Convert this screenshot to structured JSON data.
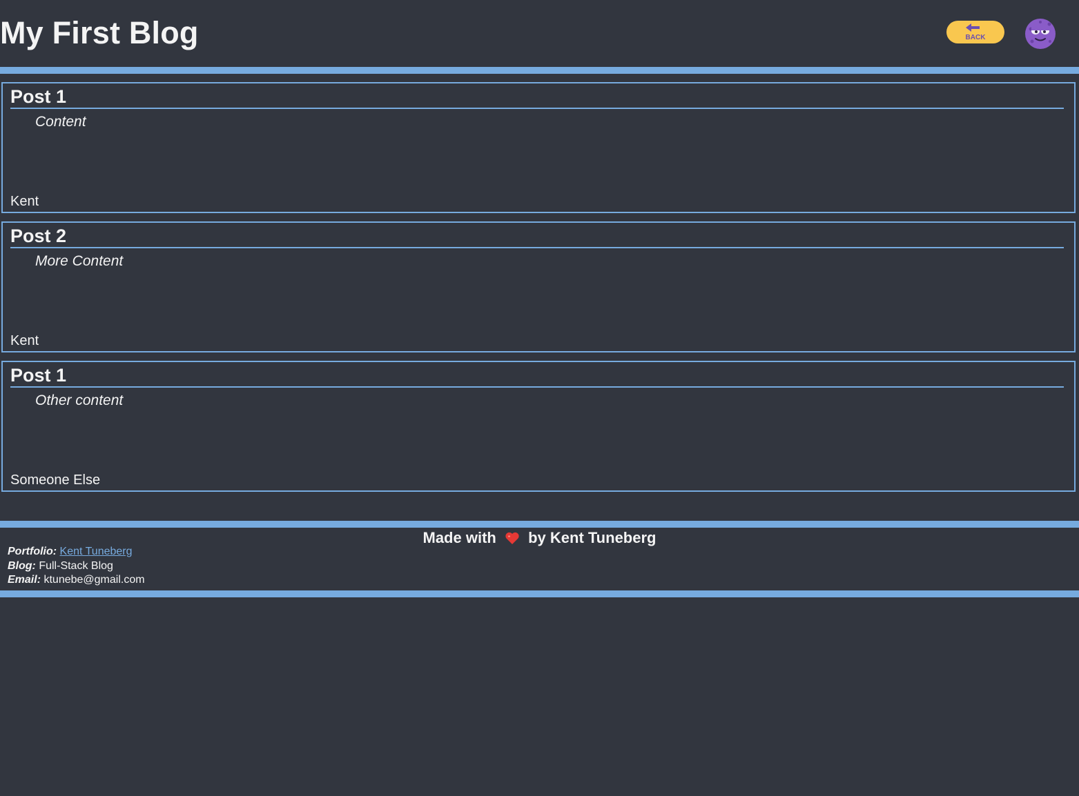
{
  "header": {
    "title": "My First Blog",
    "back_button": {
      "label": "BACK",
      "icon": "arrow-left-icon"
    },
    "avatar": {
      "icon": "purple-monster-avatar-icon"
    }
  },
  "posts": [
    {
      "title": "Post 1",
      "content": "Content",
      "author": "Kent"
    },
    {
      "title": "Post 2",
      "content": "More Content",
      "author": "Kent"
    },
    {
      "title": "Post 1",
      "content": "Other content",
      "author": "Someone Else"
    }
  ],
  "footer": {
    "credit_prefix": "Made with",
    "heart_icon": "heart-icon",
    "credit_suffix": "by Kent Tuneberg",
    "portfolio_label": "Portfolio:",
    "portfolio_link": "Kent Tuneberg",
    "blog_label": "Blog:",
    "blog_value": "Full-Stack Blog",
    "email_label": "Email:",
    "email_value": "ktunebe@gmail.com"
  },
  "colors": {
    "background": "#32363f",
    "accent": "#77abdf",
    "back_button": "#f9c74f",
    "avatar": "#8a5cc8",
    "heart": "#e53935"
  }
}
